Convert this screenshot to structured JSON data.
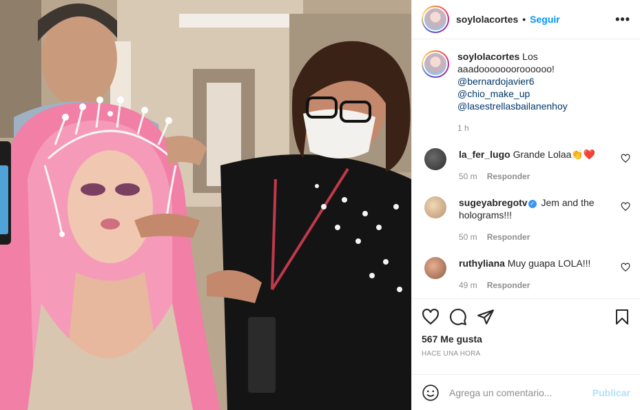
{
  "header": {
    "username": "soylolacortes",
    "separator": "•",
    "follow_label": "Seguir",
    "more_label": "•••"
  },
  "caption": {
    "username": "soylolacortes",
    "text": "Los aaadoooooooroooooo!",
    "mentions": [
      "@bernardojavier6",
      "@chio_make_up",
      "@lasestrellasbailanenhoy"
    ],
    "time": "1 h"
  },
  "comments": [
    {
      "username": "la_fer_lugo",
      "text": "Grande Lolaa👏❤️",
      "time": "50 m",
      "reply": "Responder",
      "verified": false
    },
    {
      "username": "sugeyabregotv",
      "text": "Jem and the holograms!!!",
      "time": "50 m",
      "reply": "Responder",
      "verified": true
    },
    {
      "username": "ruthyliana",
      "text": "Muy guapa LOLA!!!",
      "time": "49 m",
      "reply": "Responder",
      "verified": false
    }
  ],
  "actions": {
    "likes": "567 Me gusta",
    "posted": "HACE UNA HORA"
  },
  "composer": {
    "placeholder": "Agrega un comentario...",
    "publish_label": "Publicar"
  },
  "colors": {
    "accent": "#0095f6",
    "publish_disabled": "#b2dffc",
    "muted": "#8e8e8e",
    "mention": "#00376b"
  }
}
